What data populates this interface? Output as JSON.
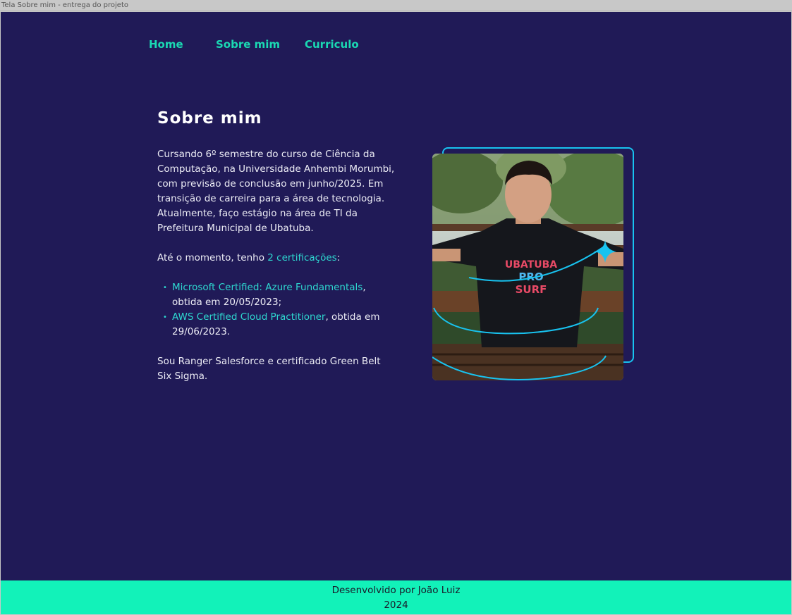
{
  "window": {
    "title": "Tela Sobre mim - entrega do projeto"
  },
  "nav": {
    "home": "Home",
    "sobre": "Sobre mim",
    "curriculo": "Curriculo"
  },
  "main": {
    "heading": "Sobre mim",
    "intro": "Cursando 6º semestre do curso de Ciência da Computação, na Universidade Anhembi Morumbi, com previsão de conclusão em junho/2025. Em transição de carreira para a área de tecnologia. Atualmente, faço estágio na área de TI da Prefeitura Municipal de Ubatuba.",
    "cert_prefix": "Até o momento, tenho ",
    "cert_link": "2 certificações",
    "cert_suffix": ":",
    "certifications": [
      {
        "name": "Microsoft Certified: Azure Fundamentals",
        "detail": ", obtida em 20/05/2023;"
      },
      {
        "name": "AWS Certified Cloud Practitioner",
        "detail": ", obtida em 29/06/2023."
      }
    ],
    "closing": "Sou Ranger Salesforce e certificado Green Belt Six Sigma.",
    "photo_shirt_text": [
      "UBATUBA",
      "PRO",
      "SURF"
    ]
  },
  "footer": {
    "line1": "Desenvolvido por João Luiz",
    "line2": "2024"
  },
  "colors": {
    "background": "#201a57",
    "accent_green": "#1ad9b3",
    "accent_cyan": "#18c3f0",
    "footer_bg": "#12f2b9"
  }
}
